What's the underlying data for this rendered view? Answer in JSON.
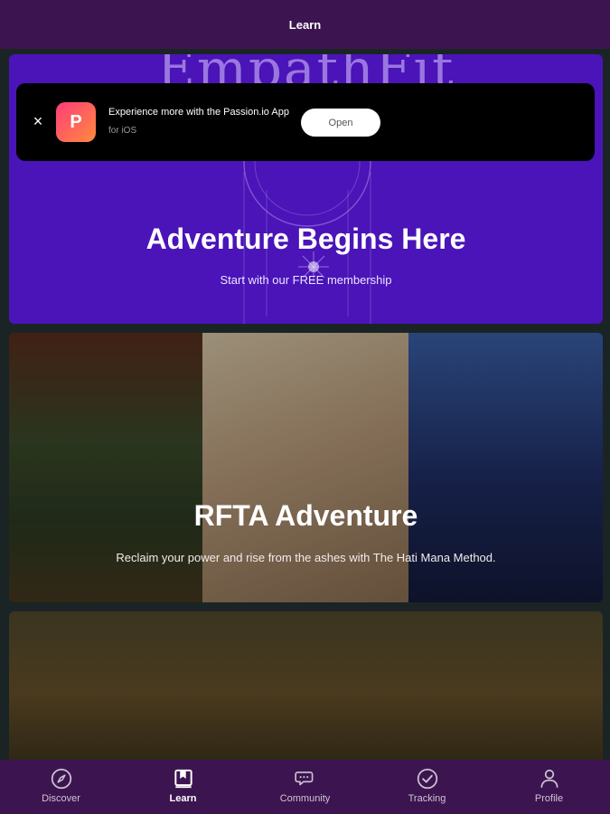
{
  "header": {
    "title": "Learn"
  },
  "cards": [
    {
      "ghost_title": "EmpathFit",
      "title": "Adventure Begins Here",
      "subtitle": "Start with our FREE membership"
    },
    {
      "title": "RFTA Adventure",
      "subtitle": "Reclaim your power and rise from the ashes with The Hati Mana Method."
    },
    {
      "title": "",
      "subtitle": ""
    }
  ],
  "banner": {
    "close_label": "×",
    "message": "Experience more with the Passion.io App",
    "platform": "for iOS",
    "open_label": "Open"
  },
  "tabs": [
    {
      "label": "Discover",
      "icon": "compass-icon"
    },
    {
      "label": "Learn",
      "icon": "book-icon",
      "active": true
    },
    {
      "label": "Community",
      "icon": "chat-icon"
    },
    {
      "label": "Tracking",
      "icon": "check-circle-icon"
    },
    {
      "label": "Profile",
      "icon": "person-icon"
    }
  ],
  "colors": {
    "header": "#3c1550",
    "tabbar": "#3c1550",
    "card1": "#4a14b8",
    "background": "#1b2424"
  }
}
